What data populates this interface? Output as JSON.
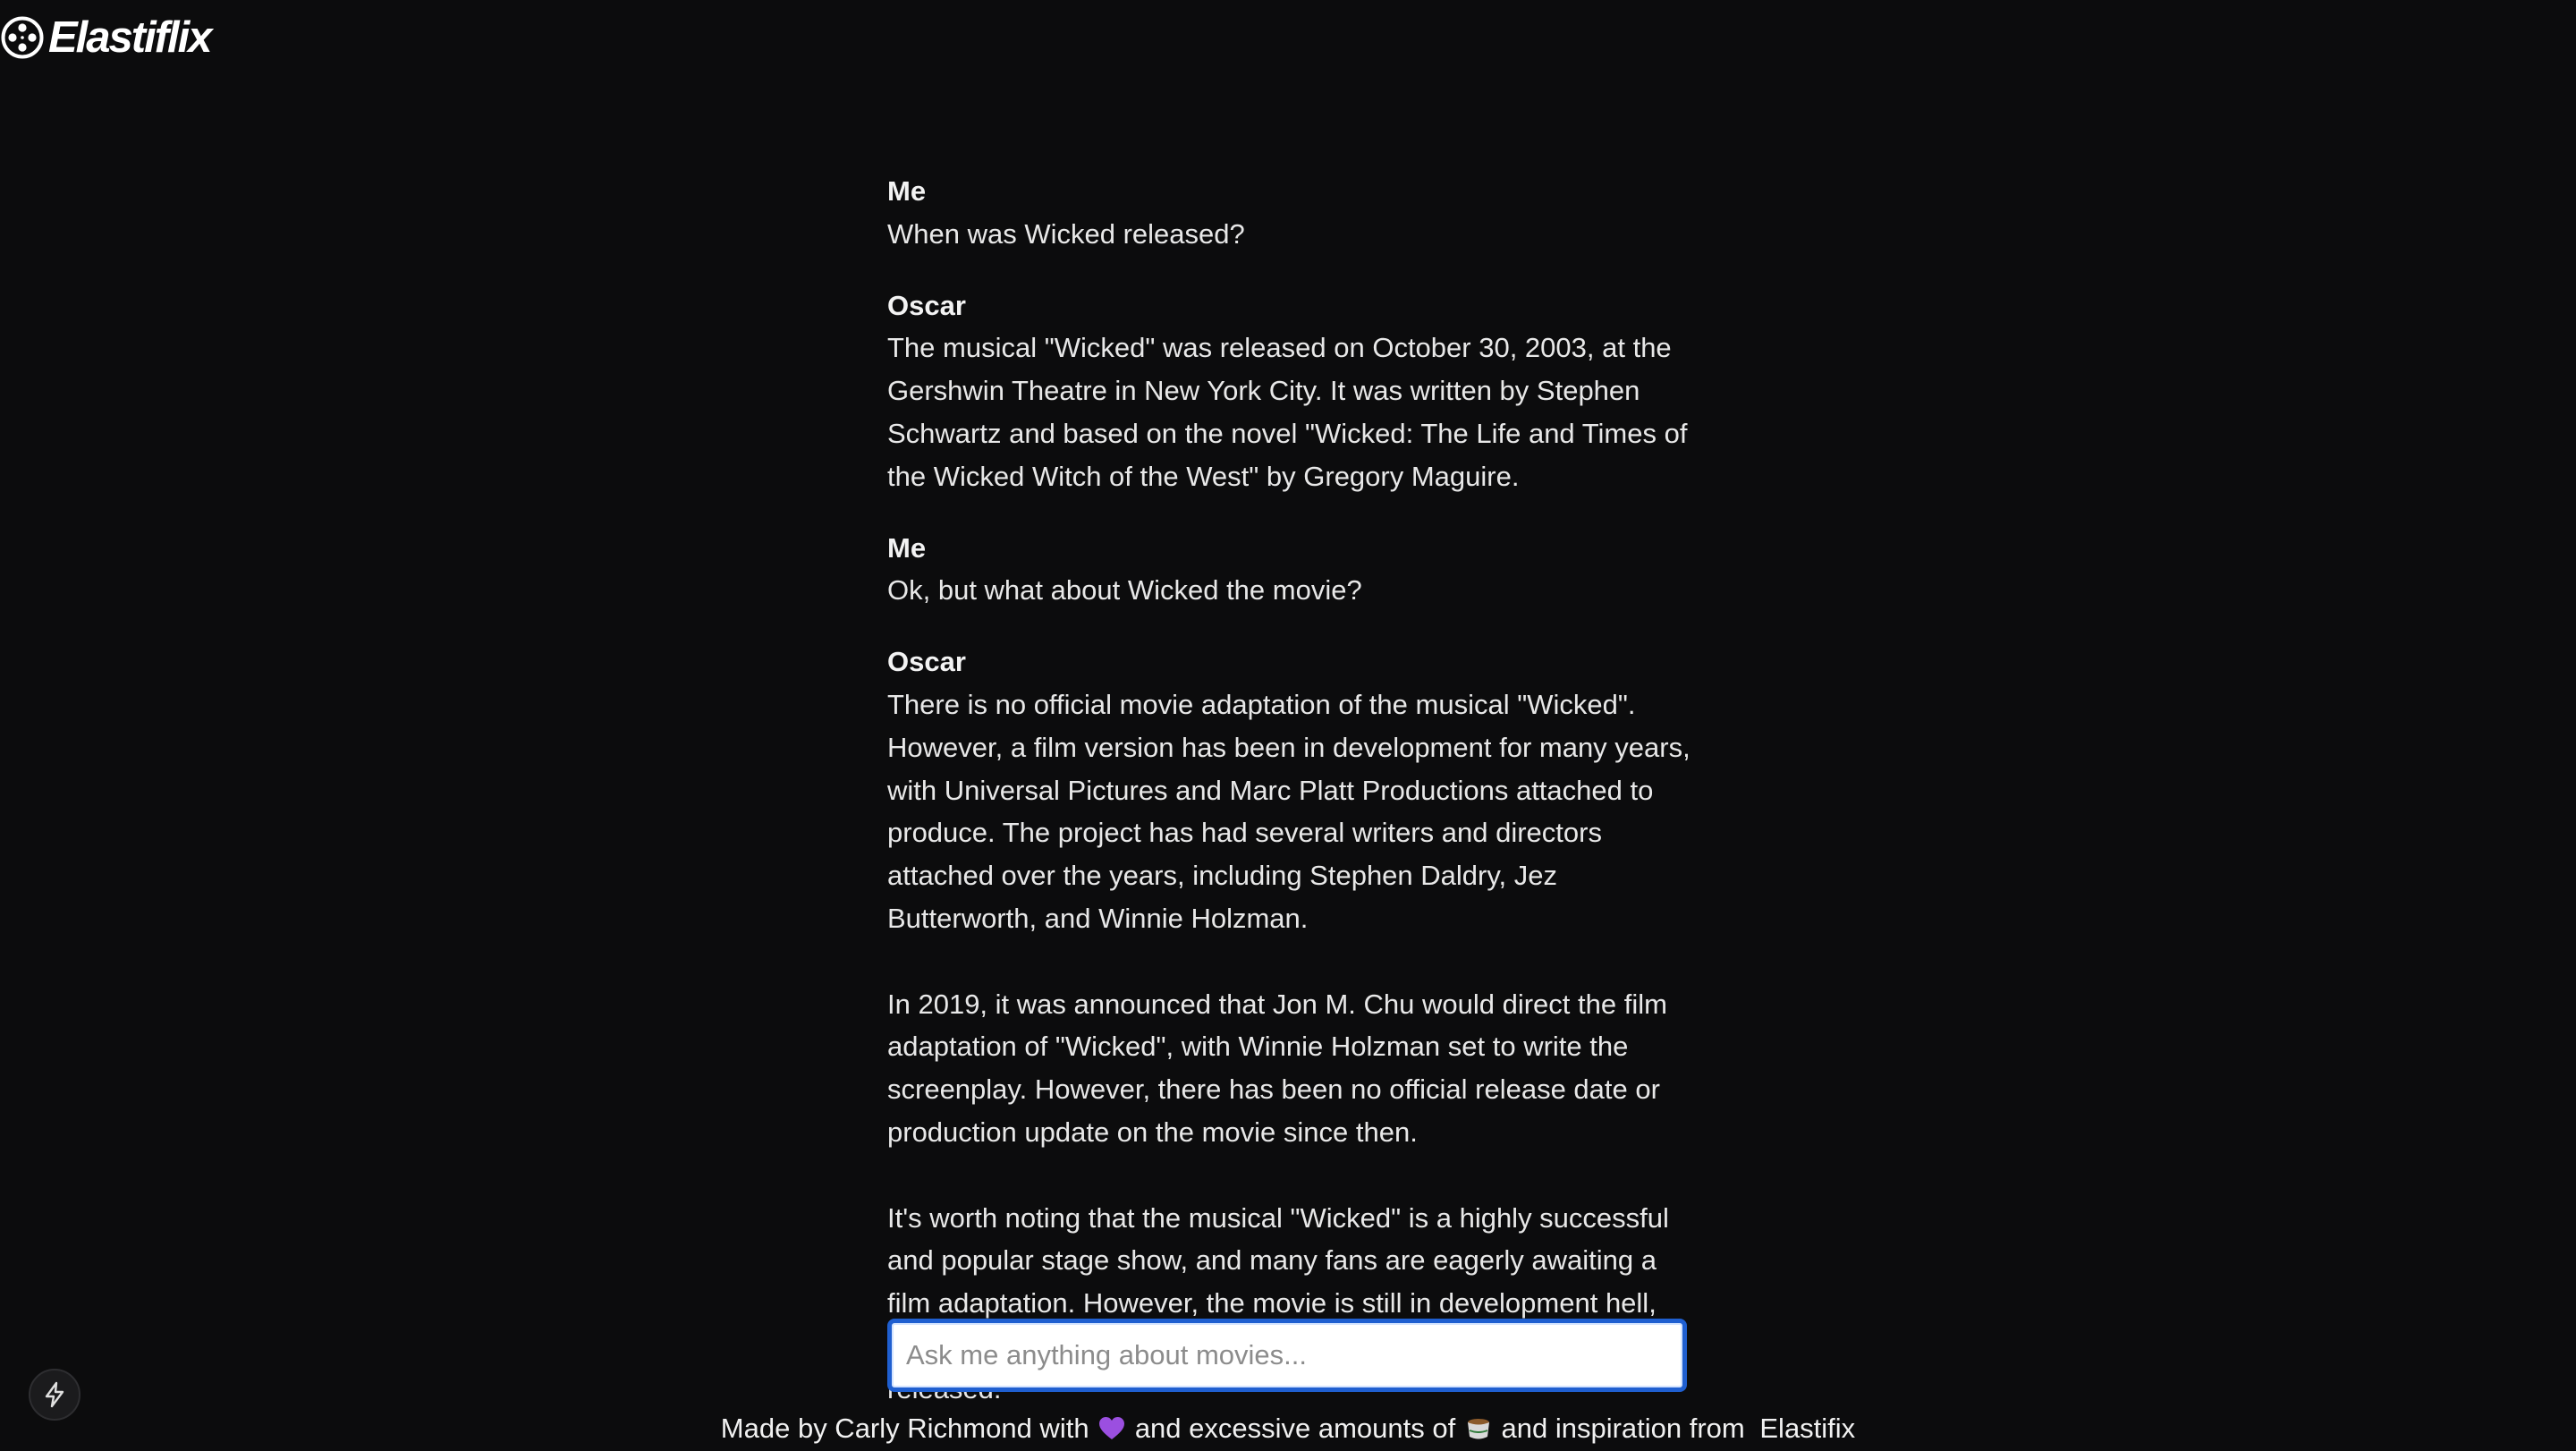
{
  "header": {
    "logo_icon": "film-reel-icon",
    "app_name": "Elastiflix"
  },
  "chat": {
    "messages": [
      {
        "speaker": "Me",
        "text": "When was Wicked released?"
      },
      {
        "speaker": "Oscar",
        "text": "The musical \"Wicked\" was released on October 30, 2003, at the Gershwin Theatre in New York City. It was written by Stephen Schwartz and based on the novel \"Wicked: The Life and Times of the Wicked Witch of the West\" by Gregory Maguire."
      },
      {
        "speaker": "Me",
        "text": "Ok, but what about Wicked the movie?"
      },
      {
        "speaker": "Oscar",
        "text": "There is no official movie adaptation of the musical \"Wicked\". However, a film version has been in development for many years, with Universal Pictures and Marc Platt Productions attached to produce. The project has had several writers and directors attached over the years, including Stephen Daldry, Jez Butterworth, and Winnie Holzman.\n\nIn 2019, it was announced that Jon M. Chu would direct the film adaptation of \"Wicked\", with Winnie Holzman set to write the screenplay. However, there has been no official release date or production update on the movie since then.\n\nIt's worth noting that the musical \"Wicked\" is a highly successful and popular stage show, and many fans are eagerly awaiting a film adaptation. However, the movie is still in development hell, and there is no clear timeline for when (or if) the movie will be released."
      }
    ]
  },
  "input": {
    "placeholder": "Ask me anything about movies...",
    "value": ""
  },
  "footer": {
    "part1": "Made by Carly Richmond with",
    "heart_icon": "purple-heart-icon",
    "part2": "and excessive amounts of",
    "cup_icon": "tea-cup-icon",
    "part3": "and inspiration from",
    "link": "Elastifix"
  },
  "floating_button": {
    "icon": "lightning-bolt-icon"
  },
  "colors": {
    "background": "#0c0c0d",
    "text": "#ececec",
    "input_border": "#1f5fd0",
    "heart": "#9b4fe0"
  }
}
